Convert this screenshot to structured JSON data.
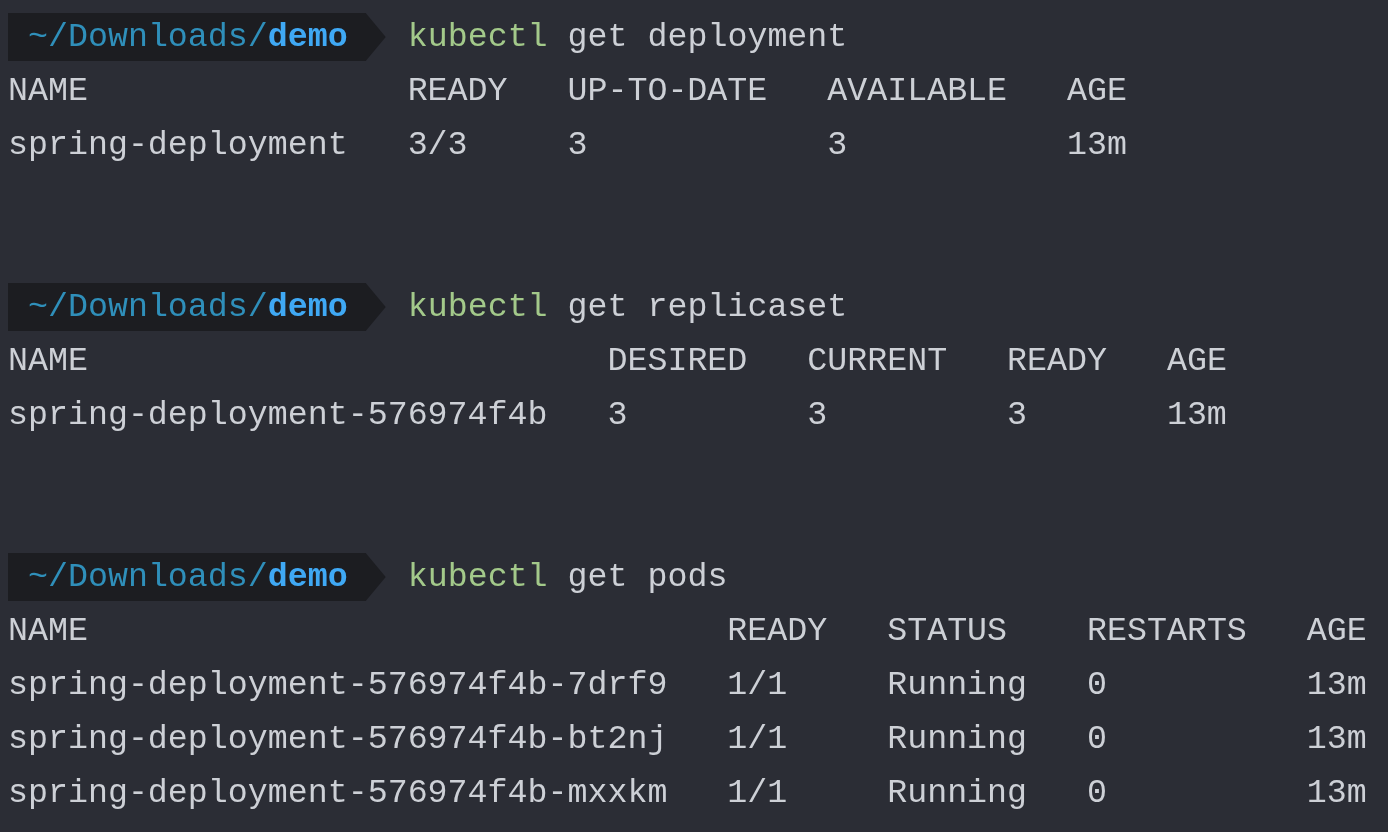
{
  "blocks": [
    {
      "prompt": {
        "path": "~/Downloads/**demo**"
      },
      "command": {
        "program": "kubectl",
        "args": "get deployment"
      },
      "columns": [
        "NAME",
        "READY",
        "UP-TO-DATE",
        "AVAILABLE",
        "AGE"
      ],
      "rows": [
        [
          "spring-deployment",
          "3/3",
          "3",
          "3",
          "13m"
        ]
      ]
    },
    {
      "prompt": {
        "path": "~/Downloads/**demo**"
      },
      "command": {
        "program": "kubectl",
        "args": "get replicaset"
      },
      "columns": [
        "NAME",
        "DESIRED",
        "CURRENT",
        "READY",
        "AGE"
      ],
      "rows": [
        [
          "spring-deployment-576974f4b",
          "3",
          "3",
          "3",
          "13m"
        ]
      ]
    },
    {
      "prompt": {
        "path": "~/Downloads/**demo**"
      },
      "command": {
        "program": "kubectl",
        "args": "get pods"
      },
      "columns": [
        "NAME",
        "READY",
        "STATUS",
        "RESTARTS",
        "AGE"
      ],
      "rows": [
        [
          "spring-deployment-576974f4b-7drf9",
          "1/1",
          "Running",
          "0",
          "13m"
        ],
        [
          "spring-deployment-576974f4b-bt2nj",
          "1/1",
          "Running",
          "0",
          "13m"
        ],
        [
          "spring-deployment-576974f4b-mxxkm",
          "1/1",
          "Running",
          "0",
          "13m"
        ]
      ]
    }
  ]
}
